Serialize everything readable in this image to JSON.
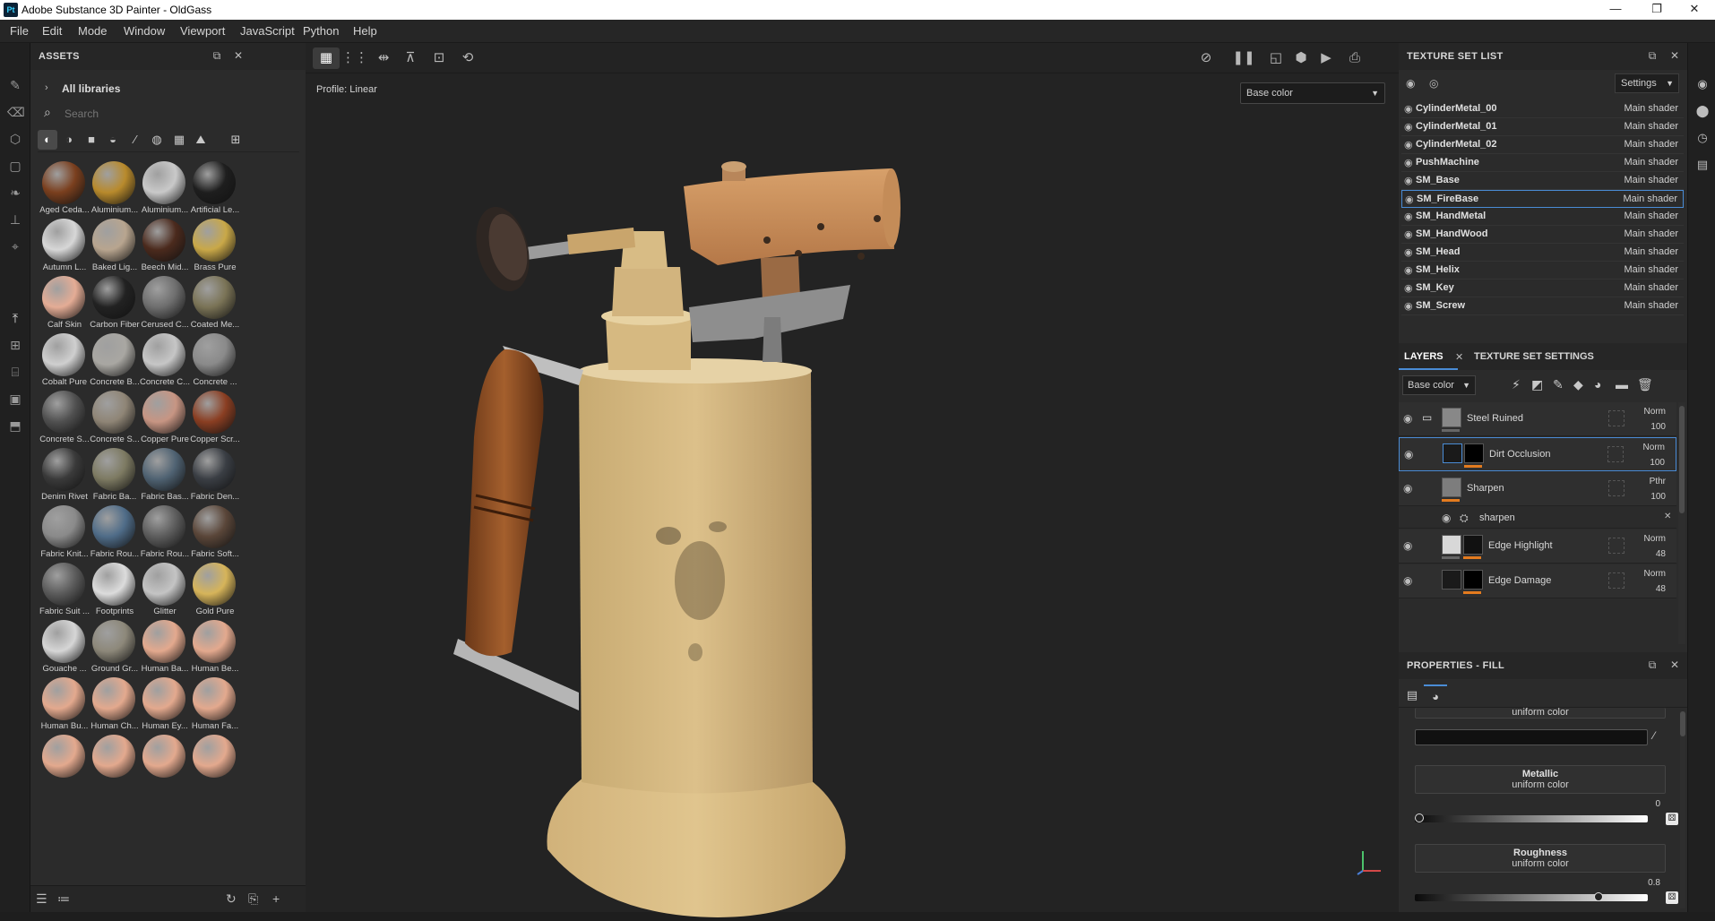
{
  "window": {
    "title": "Adobe Substance 3D Painter - OldGass",
    "app_icon": "Pt",
    "minimize": "—",
    "maximize": "❐",
    "close": "✕"
  },
  "menu": [
    "File",
    "Edit",
    "Mode",
    "Window",
    "Viewport",
    "JavaScript",
    "Python",
    "Help"
  ],
  "assets": {
    "title": "ASSETS",
    "all_libraries": "All libraries",
    "search_placeholder": "Search",
    "materials": [
      {
        "label": "Aged Ceda...",
        "color": "#7a3f1e"
      },
      {
        "label": "Aluminium...",
        "color": "#b88a2c"
      },
      {
        "label": "Aluminium...",
        "color": "#c9c9c9"
      },
      {
        "label": "Artificial Le...",
        "color": "#1e1e1e"
      },
      {
        "label": "Autumn L...",
        "color": "#d7d7d7"
      },
      {
        "label": "Baked Lig...",
        "color": "#b8a58f"
      },
      {
        "label": "Beech Mid...",
        "color": "#4b2a1d"
      },
      {
        "label": "Brass Pure",
        "color": "#c9a848"
      },
      {
        "label": "Calf Skin",
        "color": "#e4ac95"
      },
      {
        "label": "Carbon Fiber",
        "color": "#222222"
      },
      {
        "label": "Cerused C...",
        "color": "#6e6e6e"
      },
      {
        "label": "Coated Me...",
        "color": "#7a7356"
      },
      {
        "label": "Cobalt Pure",
        "color": "#cfcfcf"
      },
      {
        "label": "Concrete B...",
        "color": "#a9a7a2"
      },
      {
        "label": "Concrete C...",
        "color": "#c6c6c6"
      },
      {
        "label": "Concrete ...",
        "color": "#8a8a8a"
      },
      {
        "label": "Concrete S...",
        "color": "#505050"
      },
      {
        "label": "Concrete S...",
        "color": "#8f8576"
      },
      {
        "label": "Copper Pure",
        "color": "#c79583"
      },
      {
        "label": "Copper Scr...",
        "color": "#8a3e22"
      },
      {
        "label": "Denim Rivet",
        "color": "#3a3a3a"
      },
      {
        "label": "Fabric Ba...",
        "color": "#7d7a62"
      },
      {
        "label": "Fabric Bas...",
        "color": "#4f6272"
      },
      {
        "label": "Fabric Den...",
        "color": "#3a3e44"
      },
      {
        "label": "Fabric Knit...",
        "color": "#8a8a8a"
      },
      {
        "label": "Fabric Rou...",
        "color": "#4f6c88"
      },
      {
        "label": "Fabric Rou...",
        "color": "#5d5d5d"
      },
      {
        "label": "Fabric Soft...",
        "color": "#5a4639"
      },
      {
        "label": "Fabric Suit ...",
        "color": "#5b5b5b"
      },
      {
        "label": "Footprints",
        "color": "#dcdcdc"
      },
      {
        "label": "Glitter",
        "color": "#c4c4c4"
      },
      {
        "label": "Gold Pure",
        "color": "#d6b45a"
      },
      {
        "label": "Gouache ...",
        "color": "#d6d6d6"
      },
      {
        "label": "Ground Gr...",
        "color": "#8d887a"
      },
      {
        "label": "Human Ba...",
        "color": "#e3a98e"
      },
      {
        "label": "Human Be...",
        "color": "#e3a98e"
      },
      {
        "label": "Human Bu...",
        "color": "#e3a98e"
      },
      {
        "label": "Human Ch...",
        "color": "#e3a98e"
      },
      {
        "label": "Human Ey...",
        "color": "#e3a98e"
      },
      {
        "label": "Human Fa...",
        "color": "#e3a98e"
      },
      {
        "label": "",
        "color": "#e3a98e"
      },
      {
        "label": "",
        "color": "#e3a98e"
      },
      {
        "label": "",
        "color": "#e3a98e"
      },
      {
        "label": "",
        "color": "#e3a98e"
      }
    ]
  },
  "viewport": {
    "profile": "Profile: Linear",
    "channel": "Base color"
  },
  "texture_set_list": {
    "title": "TEXTURE SET LIST",
    "settings": "Settings",
    "rows": [
      {
        "name": "CylinderMetal_00",
        "shader": "Main shader"
      },
      {
        "name": "CylinderMetal_01",
        "shader": "Main shader"
      },
      {
        "name": "CylinderMetal_02",
        "shader": "Main shader"
      },
      {
        "name": "PushMachine",
        "shader": "Main shader"
      },
      {
        "name": "SM_Base",
        "shader": "Main shader"
      },
      {
        "name": "SM_FireBase",
        "shader": "Main shader"
      },
      {
        "name": "SM_HandMetal",
        "shader": "Main shader"
      },
      {
        "name": "SM_HandWood",
        "shader": "Main shader"
      },
      {
        "name": "SM_Head",
        "shader": "Main shader"
      },
      {
        "name": "SM_Helix",
        "shader": "Main shader"
      },
      {
        "name": "SM_Key",
        "shader": "Main shader"
      },
      {
        "name": "SM_Screw",
        "shader": "Main shader"
      }
    ],
    "selected": "SM_FireBase"
  },
  "layers": {
    "tab_layers": "LAYERS",
    "tab_settings": "TEXTURE SET SETTINGS",
    "channel": "Base color",
    "rows": [
      {
        "name": "Steel Ruined",
        "blend": "Norm",
        "opacity": "100"
      },
      {
        "name": "Dirt Occlusion",
        "blend": "Norm",
        "opacity": "100"
      },
      {
        "name": "Sharpen",
        "blend": "Pthr",
        "opacity": "100"
      },
      {
        "name": "sharpen"
      },
      {
        "name": "Edge Highlight",
        "blend": "Norm",
        "opacity": "48"
      },
      {
        "name": "Edge Damage",
        "blend": "Norm",
        "opacity": "48"
      }
    ]
  },
  "properties": {
    "title": "PROPERTIES - FILL",
    "color_mode": "uniform color",
    "metallic": {
      "label": "Metallic",
      "mode": "uniform color",
      "value": "0",
      "fraction": 0
    },
    "roughness": {
      "label": "Roughness",
      "mode": "uniform color",
      "value": "0.8",
      "fraction": 0.8
    }
  }
}
